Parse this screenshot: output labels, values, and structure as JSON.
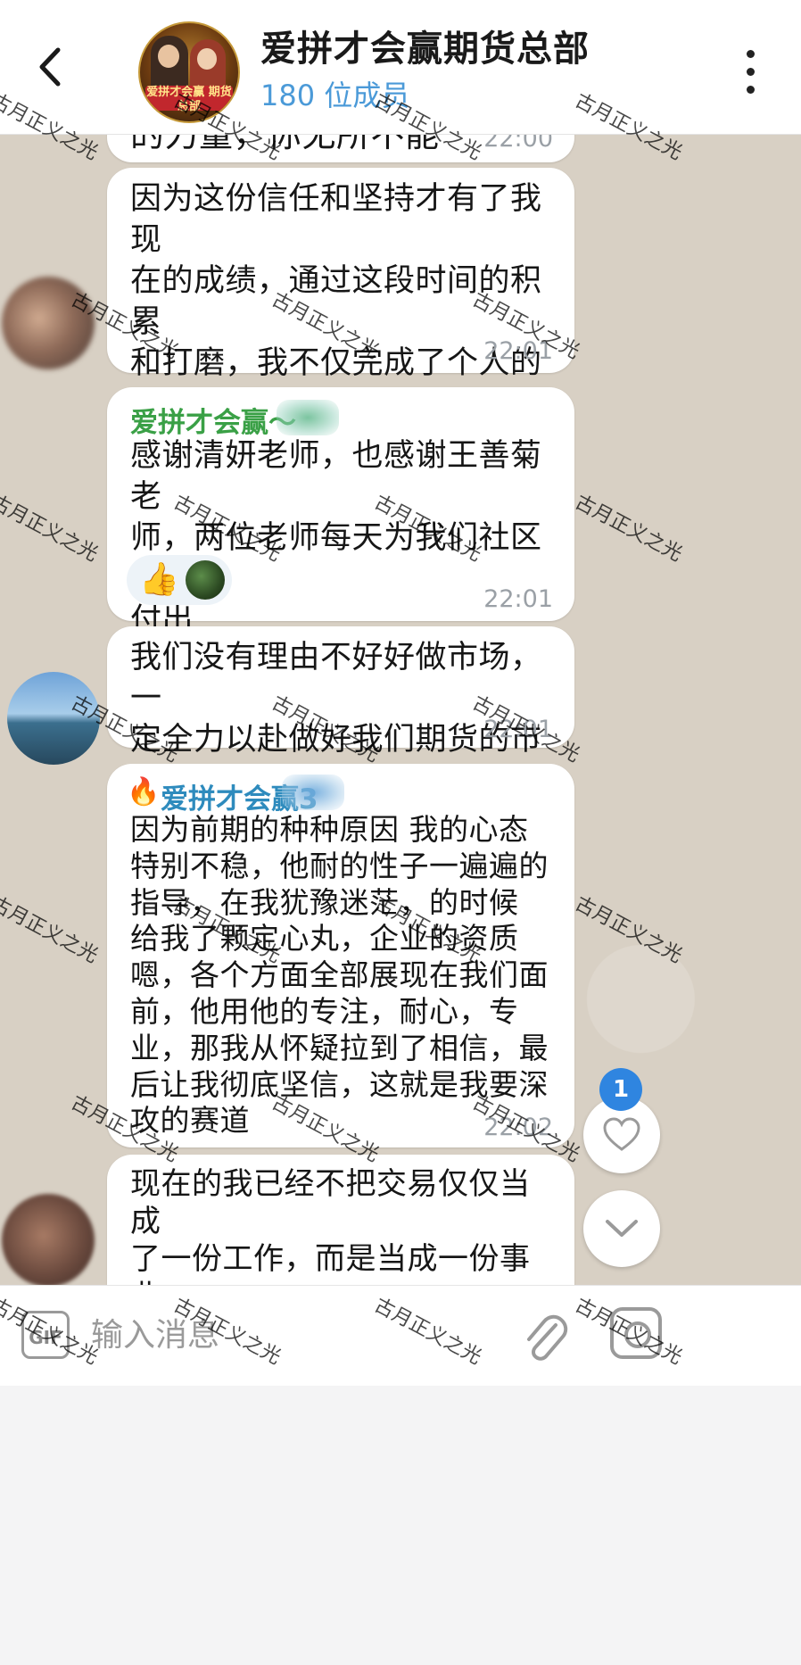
{
  "header": {
    "back_icon": "chevron-left-icon",
    "group_avatar_caption": "爱拼才会赢 期货总部",
    "title": "爱拼才会赢期货总部",
    "subtitle": "180 位成员",
    "menu_icon": "more-vert-icon"
  },
  "messages": [
    {
      "text": "的力量，你无所不能",
      "time": "22:00"
    },
    {
      "text": "因为这份信任和坚持才有了我现\n在的成绩，通过这段时间的积累\n和打磨，我不仅完成了个人的成\n长，也很荣幸能够和团队一起实\n现了团队的小小裂变",
      "time": "22:01"
    },
    {
      "sender": "爱拼才会赢～",
      "text": "感谢清妍老师，也感谢王善菊老\n师，两位老师每天为我们社区的\n付出",
      "time": "22:01",
      "reaction": "👍"
    },
    {
      "text": "我们没有理由不好好做市场，一\n定全力以赴做好我们期货的市场",
      "time": "22:01"
    },
    {
      "sender_emoji": "🔥",
      "sender": "爱拼才会赢3",
      "text": "因为前期的种种原因 我的心态\n特别不稳，他耐的性子一遍遍的\n指导，在我犹豫迷茫，的时候\n给我了颗定心丸，企业的资质\n嗯，各个方面全部展现在我们面\n前，他用他的专注，耐心，专\n业，那我从怀疑拉到了相信，最\n后让我彻底坚信，这就是我要深\n攻的赛道",
      "time": "22:02"
    },
    {
      "text": "现在的我已经不把交易仅仅当成\n了一份工作，而是当成一份事业\n在做，虽然取得了一点小小的成",
      "time": ""
    }
  ],
  "floating": {
    "badge_count": "1",
    "like_icon": "heart-icon",
    "scroll_icon": "chevron-down-icon"
  },
  "input": {
    "gif_label": "GIF",
    "placeholder": "输入消息",
    "attach_icon": "paperclip-icon",
    "camera_icon": "camera-icon"
  },
  "watermark": "古月正义之光",
  "colors": {
    "sender_green": "#3aa046",
    "sender_blue": "#2e8bbd",
    "member_count": "#4b9ad8",
    "badge": "#2f85e0"
  }
}
